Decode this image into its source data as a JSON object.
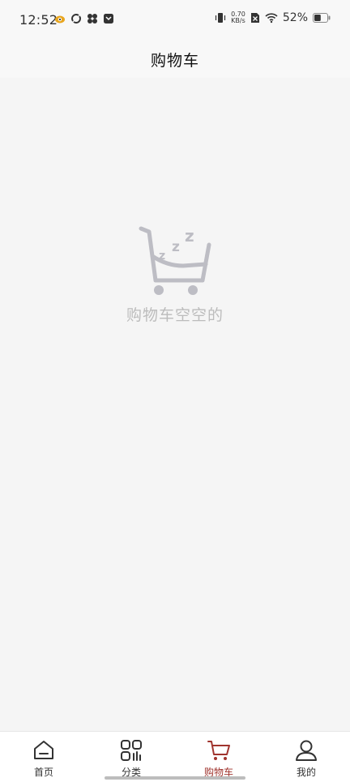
{
  "status_bar": {
    "time": "12:52",
    "net_speed_value": "0.70",
    "net_speed_unit": "KB/s",
    "battery": "52%",
    "battery_level": 0.52
  },
  "header": {
    "title": "购物车"
  },
  "empty_state": {
    "message": "购物车空空的",
    "icon": "empty-cart-icon",
    "zzz": "z"
  },
  "tab_bar": {
    "tabs": [
      {
        "label": "首页",
        "icon": "home-icon",
        "active": false
      },
      {
        "label": "分类",
        "icon": "category-icon",
        "active": false
      },
      {
        "label": "购物车",
        "icon": "cart-icon",
        "active": true
      },
      {
        "label": "我的",
        "icon": "user-icon",
        "active": false
      }
    ]
  },
  "colors": {
    "active": "#a0342e",
    "inactive": "#333333",
    "empty_gray": "#bcbcbc",
    "background": "#f5f5f5"
  }
}
